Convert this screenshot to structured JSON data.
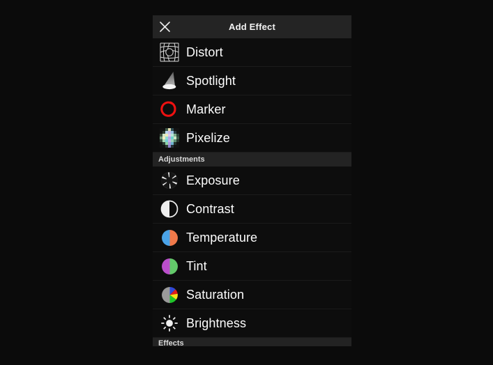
{
  "window": {
    "background_color": "#0b0b0b"
  },
  "panel": {
    "background_color": "#0d0d0d",
    "header": {
      "title": "Add Effect",
      "close_icon": "close-icon",
      "background_color": "#242424"
    },
    "items": [
      {
        "label": "Distort",
        "icon": "distort-icon"
      },
      {
        "label": "Spotlight",
        "icon": "spotlight-icon"
      },
      {
        "label": "Marker",
        "icon": "marker-icon"
      },
      {
        "label": "Pixelize",
        "icon": "pixelize-icon"
      }
    ],
    "sections": [
      {
        "header": "Adjustments",
        "items": [
          {
            "label": "Exposure",
            "icon": "aperture-icon"
          },
          {
            "label": "Contrast",
            "icon": "contrast-icon"
          },
          {
            "label": "Temperature",
            "icon": "temperature-icon"
          },
          {
            "label": "Tint",
            "icon": "tint-icon"
          },
          {
            "label": "Saturation",
            "icon": "saturation-icon"
          },
          {
            "label": "Brightness",
            "icon": "sun-icon"
          }
        ]
      },
      {
        "header": "Effects",
        "items": []
      }
    ],
    "colors": {
      "marker_red": "#ee1111",
      "temperature_cold": "#4aa3e8",
      "temperature_warm": "#f0794a",
      "tint_magenta": "#bb4ecb",
      "tint_green": "#63c96a",
      "saturation_gray": "#9a9a9a",
      "divider": "#1b1b1b",
      "section_header_bg": "#232323",
      "label_text": "#fdfdfd"
    }
  }
}
